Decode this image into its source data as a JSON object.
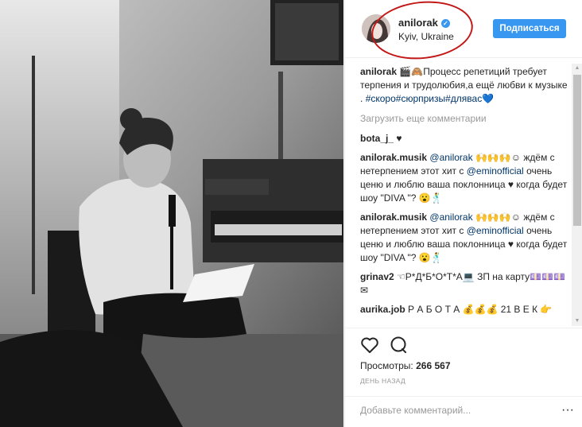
{
  "post": {
    "username": "anilorak",
    "location": "Kyiv, Ukraine",
    "follow_label": "Подписаться",
    "caption_user": "anilorak",
    "caption_text": "🎬🙈Процесс репетиций требует терпения и трудолюбия,а ещё любви к музыке .",
    "caption_tags": "#скоро#сюрпризы#длявас💙",
    "load_more": "Загрузить еще комментарии",
    "comments": [
      {
        "user": "bota_j_",
        "text": "♥"
      },
      {
        "user": "anilorak.musik",
        "mention": "@anilorak",
        "text": "🙌🙌🙌☺ ждём с нетерпением этот хит с",
        "mention2": "@eminofficial",
        "text2": "очень ценю и люблю ваша поклонница ♥ когда будет шоу \"DIVA \"? 😮🕺"
      },
      {
        "user": "anilorak.musik",
        "mention": "@anilorak",
        "text": "🙌🙌🙌☺ ждём с нетерпением этот хит с",
        "mention2": "@eminofficial",
        "text2": "очень ценю и люблю ваша поклонница ♥ когда будет шоу \"DIVA \"? 😮🕺"
      },
      {
        "user": "grinav2",
        "text": "☜Р*Д*Б*О*Т*А💻 ЗП на карту💷💷💷✉"
      },
      {
        "user": "aurika.job",
        "text": "Р А Б О Т А 💰💰💰 21 В Е К 👉"
      }
    ],
    "views_label": "Просмотры:",
    "views_count": "266 567",
    "date": "ДЕНЬ НАЗАД",
    "add_comment_placeholder": "Добавьте комментарий...",
    "more_label": "···"
  },
  "colors": {
    "accent": "#3897f0",
    "annotation_circle": "#c21818",
    "mention": "#003569"
  },
  "icons": [
    "heart-icon",
    "comment-icon",
    "verified-badge-icon",
    "more-options-icon"
  ]
}
